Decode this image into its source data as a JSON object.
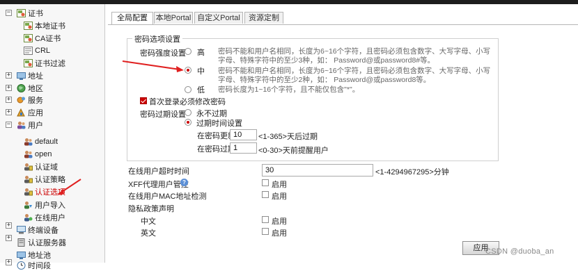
{
  "sidebar": {
    "items": [
      {
        "label": "证书",
        "icon": "certificate-folder-icon"
      },
      {
        "label": "本地证书",
        "icon": "local-certificate-icon"
      },
      {
        "label": "CA证书",
        "icon": "ca-certificate-icon"
      },
      {
        "label": "CRL",
        "icon": "crl-icon"
      },
      {
        "label": "证书过滤",
        "icon": "certificate-filter-icon"
      },
      {
        "label": "地址",
        "icon": "address-icon"
      },
      {
        "label": "地区",
        "icon": "region-globe-icon"
      },
      {
        "label": "服务",
        "icon": "service-icon"
      },
      {
        "label": "应用",
        "icon": "application-icon"
      },
      {
        "label": "用户",
        "icon": "users-icon"
      },
      {
        "label": "default",
        "icon": "user-group-icon"
      },
      {
        "label": "open",
        "icon": "user-group-icon"
      },
      {
        "label": "认证域",
        "icon": "auth-domain-icon"
      },
      {
        "label": "认证策略",
        "icon": "auth-policy-icon"
      },
      {
        "label": "认证选项",
        "icon": "auth-options-icon"
      },
      {
        "label": "用户导入",
        "icon": "user-import-icon"
      },
      {
        "label": "在线用户",
        "icon": "online-users-icon"
      },
      {
        "label": "终端设备",
        "icon": "terminal-device-icon"
      },
      {
        "label": "认证服务器",
        "icon": "auth-server-icon"
      },
      {
        "label": "地址池",
        "icon": "address-pool-icon"
      },
      {
        "label": "时间段",
        "icon": "time-range-icon"
      }
    ],
    "selected": "认证选项",
    "accent": "#cc0000"
  },
  "tabs": [
    {
      "label": "全局配置",
      "active": true
    },
    {
      "label": "本地Portal",
      "active": false
    },
    {
      "label": "自定义Portal",
      "active": false
    },
    {
      "label": "资源定制",
      "active": false
    }
  ],
  "password_options": {
    "group_title": "密码选项设置",
    "strength_label": "密码强度设置",
    "levels": [
      {
        "label": "高",
        "selected": false,
        "desc": [
          "密码不能和用户名相同，长度为6~16个字符，且密码必须包含数字、大写字母、小写",
          "字母、特殊字符中的至少3种，如： Password@或password8#等。"
        ]
      },
      {
        "label": "中",
        "selected": true,
        "desc": [
          "密码不能和用户名相同，长度为6~16个字符，且密码必须包含数字、大写字母、小写",
          "字母、特殊字符中的至少2种，如： Password@或password8等。"
        ]
      },
      {
        "label": "低",
        "selected": false,
        "desc": [
          "密码长度为1~16个字符，且不能仅包含\"*\"。"
        ]
      }
    ],
    "first_login_change": {
      "label": "首次登录必须修改密码",
      "checked": true
    },
    "expire_label": "密码过期设置",
    "expire_options": [
      {
        "label": "永不过期",
        "selected": false
      },
      {
        "label": "过期时间设置",
        "selected": true
      }
    ],
    "update_after": {
      "label": "在密码更新",
      "value": "10",
      "hint": "<1-365>天后过期"
    },
    "remind_before": {
      "label": "在密码过期",
      "value": "1",
      "hint": "<0-30>天前提醒用户"
    }
  },
  "settings": {
    "timeout": {
      "label": "在线用户超时时间",
      "value": "30",
      "hint": "<1-4294967295>分钟"
    },
    "xff": {
      "label": "XFF代理用户管控",
      "help_icon": "help-icon",
      "enable_label": "启用",
      "checked": false
    },
    "mac_check": {
      "label": "在线用户MAC地址检测",
      "enable_label": "启用",
      "checked": false
    },
    "privacy": {
      "label": "隐私政策声明"
    },
    "chinese": {
      "label": "中文",
      "enable_label": "启用",
      "checked": false
    },
    "english": {
      "label": "英文",
      "enable_label": "启用",
      "checked": false
    }
  },
  "apply_label": "应用",
  "watermark": "CSDN @duoba_an"
}
